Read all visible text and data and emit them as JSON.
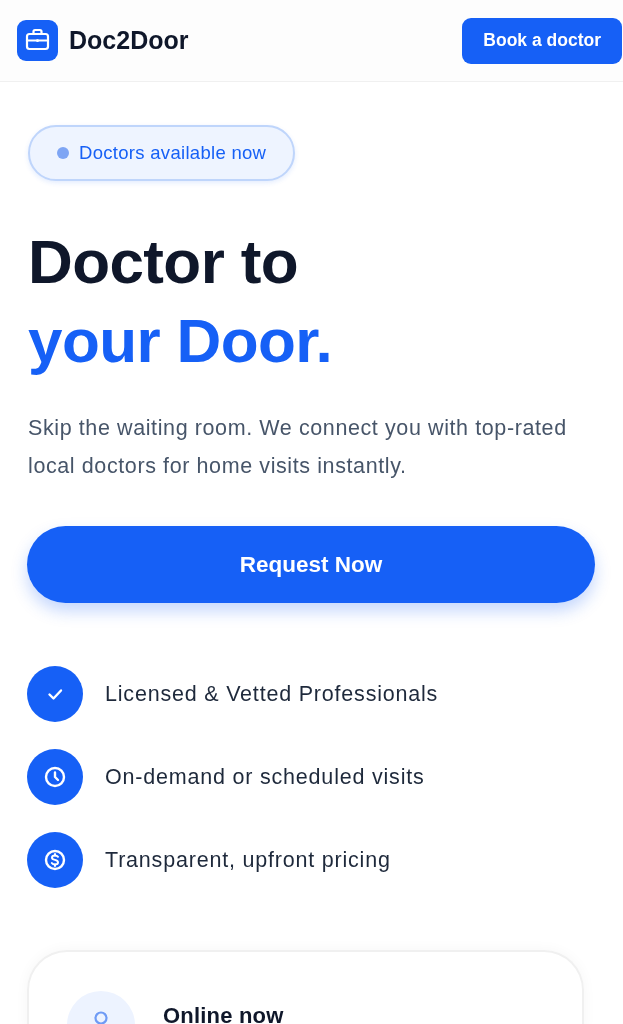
{
  "header": {
    "brand": "Doc2Door",
    "button": "Book a doctor"
  },
  "hero": {
    "badge": "Doctors available now",
    "title_lines": [
      {
        "text": "Doctor to",
        "accent": false
      },
      {
        "text": "your Door.",
        "accent": true
      }
    ],
    "description": "Skip the waiting room. We connect you with top-rated local doctors for home visits instantly.",
    "cta": "Request Now"
  },
  "features": [
    {
      "kind": "check",
      "text": "Licensed & Vetted Professionals"
    },
    {
      "kind": "clock",
      "text": "On-demand or scheduled visits"
    },
    {
      "kind": "dollar",
      "text": "Transparent, upfront pricing"
    }
  ],
  "status_card": {
    "title": "Online now"
  }
}
